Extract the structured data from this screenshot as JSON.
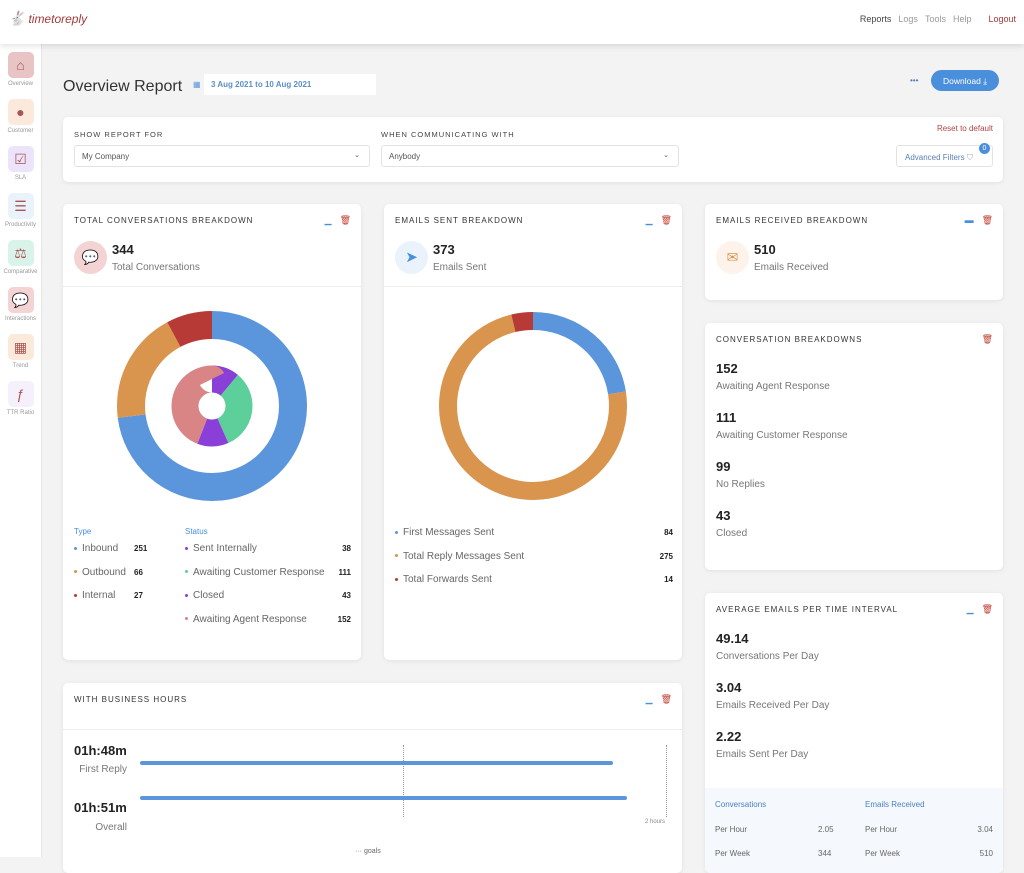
{
  "app": {
    "logo_text": "timetoreply",
    "nav": [
      "Reports",
      "Logs",
      "Tools",
      "Help"
    ],
    "logout": "Logout"
  },
  "sidebar": [
    {
      "label": "Overview",
      "icon": "home-icon",
      "color": "#e8c4c4"
    },
    {
      "label": "Customer",
      "icon": "user-icon",
      "color": "#fbeadb"
    },
    {
      "label": "SLA",
      "icon": "calendar-check-icon",
      "color": "#ece4fb"
    },
    {
      "label": "Productivity",
      "icon": "checklist-icon",
      "color": "#eaf2fb"
    },
    {
      "label": "Comparative",
      "icon": "scales-icon",
      "color": "#d9f3ea"
    },
    {
      "label": "Interactions",
      "icon": "chat-bubbles-icon",
      "color": "#f3d3d3"
    },
    {
      "label": "Trend",
      "icon": "calendar-icon",
      "color": "#fbeadb"
    },
    {
      "label": "TTR Ratio",
      "icon": "function-icon",
      "color": "#f5f0fb"
    }
  ],
  "page": {
    "title": "Overview Report",
    "date_range": "3 Aug 2021 to 10 Aug 2021",
    "download": "Download",
    "more": "•••"
  },
  "filters": {
    "show_label": "SHOW REPORT FOR",
    "show_value": "My Company",
    "with_label": "WHEN COMMUNICATING WITH",
    "with_value": "Anybody",
    "reset": "Reset to default",
    "advanced": "Advanced Filters",
    "advanced_count": "0"
  },
  "total": {
    "title": "TOTAL CONVERSATIONS BREAKDOWN",
    "value": "344",
    "label": "Total Conversations",
    "type_header": "Type",
    "status_header": "Status",
    "types": [
      {
        "label": "Inbound",
        "value": 251,
        "color": "#5b96dc"
      },
      {
        "label": "Outbound",
        "value": 66,
        "color": "#d9944d"
      },
      {
        "label": "Internal",
        "value": 27,
        "color": "#b83a36"
      }
    ],
    "statuses": [
      {
        "label": "Sent Internally",
        "value": 38,
        "color": "#8a3fd8"
      },
      {
        "label": "Awaiting Customer Response",
        "value": 111,
        "color": "#5ccf9a"
      },
      {
        "label": "Closed",
        "value": 43,
        "color": "#8a3fd8"
      },
      {
        "label": "Awaiting Agent Response",
        "value": 152,
        "color": "#d98585"
      }
    ]
  },
  "sent": {
    "title": "EMAILS SENT BREAKDOWN",
    "value": "373",
    "label": "Emails Sent",
    "items": [
      {
        "label": "First Messages Sent",
        "value": 84,
        "color": "#5b96dc"
      },
      {
        "label": "Total Reply Messages Sent",
        "value": 275,
        "color": "#d9944d"
      },
      {
        "label": "Total Forwards Sent",
        "value": 14,
        "color": "#b83a36"
      }
    ]
  },
  "received": {
    "title": "EMAILS RECEIVED BREAKDOWN",
    "value": "510",
    "label": "Emails Received"
  },
  "breakdowns": {
    "title": "CONVERSATION BREAKDOWNS",
    "items": [
      {
        "value": "152",
        "label": "Awaiting Agent Response"
      },
      {
        "value": "111",
        "label": "Awaiting Customer Response"
      },
      {
        "value": "99",
        "label": "No Replies"
      },
      {
        "value": "43",
        "label": "Closed"
      }
    ]
  },
  "average": {
    "title": "AVERAGE EMAILS PER TIME INTERVAL",
    "items": [
      {
        "value": "49.14",
        "label": "Conversations Per Day"
      },
      {
        "value": "3.04",
        "label": "Emails Received Per Day"
      },
      {
        "value": "2.22",
        "label": "Emails Sent Per Day"
      }
    ],
    "table": {
      "col1": "Conversations",
      "col2": "Emails Received",
      "rows": [
        {
          "label": "Per Hour",
          "v1": "2.05",
          "v2": "3.04"
        },
        {
          "label": "Per Week",
          "v1": "344",
          "v2": "510"
        }
      ]
    }
  },
  "business": {
    "title": "WITH BUSINESS HOURS",
    "axis_max_label": "2 hours",
    "legend": "goals",
    "axis_max_minutes": 120,
    "goal_minutes": 60,
    "rows": [
      {
        "value": "01h:48m",
        "label": "First Reply",
        "minutes": 108
      },
      {
        "value": "01h:51m",
        "label": "Overall",
        "minutes": 111
      }
    ]
  }
}
